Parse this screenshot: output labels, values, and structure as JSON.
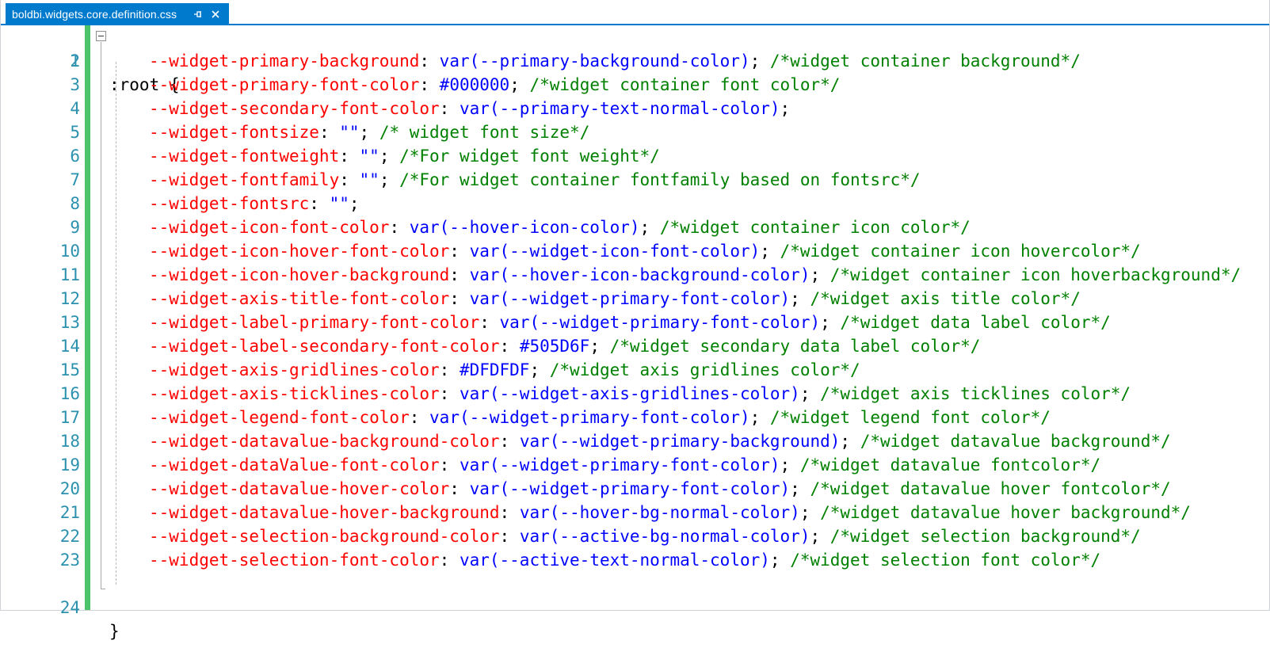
{
  "tab": {
    "title": "boldbi.widgets.core.definition.css",
    "pin_icon": "pin-icon",
    "close_icon": "close-icon"
  },
  "colors": {
    "accent": "#007acc",
    "line_number": "#2b91af",
    "property": "#ff0000",
    "value": "#0000ff",
    "comment": "#008000",
    "change_bar": "#4ec46a"
  },
  "code": {
    "open": ":root {",
    "close": "}",
    "lines": [
      {
        "n": "2",
        "prop": "--widget-primary-background",
        "sep": ": ",
        "val": "var(--primary-background-color)",
        "end": "; ",
        "cmt": "/*widget container background*/"
      },
      {
        "n": "3",
        "prop": "--widget-primary-font-color",
        "sep": ": ",
        "val": "#000000",
        "end": "; ",
        "cmt": "/*widget container font color*/"
      },
      {
        "n": "4",
        "prop": "--widget-secondary-font-color",
        "sep": ": ",
        "val": "var(--primary-text-normal-color)",
        "end": ";",
        "cmt": ""
      },
      {
        "n": "5",
        "prop": "--widget-fontsize",
        "sep": ": ",
        "val": "\"\"",
        "end": "; ",
        "cmt": "/* widget font size*/"
      },
      {
        "n": "6",
        "prop": "--widget-fontweight",
        "sep": ": ",
        "val": "\"\"",
        "end": "; ",
        "cmt": "/*For widget font weight*/"
      },
      {
        "n": "7",
        "prop": "--widget-fontfamily",
        "sep": ": ",
        "val": "\"\"",
        "end": "; ",
        "cmt": "/*For widget container fontfamily based on fontsrc*/"
      },
      {
        "n": "8",
        "prop": "--widget-fontsrc",
        "sep": ": ",
        "val": "\"\"",
        "end": ";",
        "cmt": ""
      },
      {
        "n": "9",
        "prop": "--widget-icon-font-color",
        "sep": ": ",
        "val": "var(--hover-icon-color)",
        "end": "; ",
        "cmt": "/*widget container icon color*/"
      },
      {
        "n": "10",
        "prop": "--widget-icon-hover-font-color",
        "sep": ": ",
        "val": "var(--widget-icon-font-color)",
        "end": "; ",
        "cmt": "/*widget container icon hovercolor*/"
      },
      {
        "n": "11",
        "prop": "--widget-icon-hover-background",
        "sep": ": ",
        "val": "var(--hover-icon-background-color)",
        "end": "; ",
        "cmt": "/*widget container icon hoverbackground*/"
      },
      {
        "n": "12",
        "prop": "--widget-axis-title-font-color",
        "sep": ": ",
        "val": "var(--widget-primary-font-color)",
        "end": "; ",
        "cmt": "/*widget axis title color*/"
      },
      {
        "n": "13",
        "prop": "--widget-label-primary-font-color",
        "sep": ": ",
        "val": "var(--widget-primary-font-color)",
        "end": "; ",
        "cmt": "/*widget data label color*/"
      },
      {
        "n": "14",
        "prop": "--widget-label-secondary-font-color",
        "sep": ": ",
        "val": "#505D6F",
        "end": "; ",
        "cmt": "/*widget secondary data label color*/"
      },
      {
        "n": "15",
        "prop": "--widget-axis-gridlines-color",
        "sep": ": ",
        "val": "#DFDFDF",
        "end": "; ",
        "cmt": "/*widget axis gridlines color*/"
      },
      {
        "n": "16",
        "prop": "--widget-axis-ticklines-color",
        "sep": ": ",
        "val": "var(--widget-axis-gridlines-color)",
        "end": "; ",
        "cmt": "/*widget axis ticklines color*/"
      },
      {
        "n": "17",
        "prop": "--widget-legend-font-color",
        "sep": ": ",
        "val": "var(--widget-primary-font-color)",
        "end": "; ",
        "cmt": "/*widget legend font color*/"
      },
      {
        "n": "18",
        "prop": "--widget-datavalue-background-color",
        "sep": ": ",
        "val": "var(--widget-primary-background)",
        "end": "; ",
        "cmt": "/*widget datavalue background*/"
      },
      {
        "n": "19",
        "prop": "--widget-dataValue-font-color",
        "sep": ": ",
        "val": "var(--widget-primary-font-color)",
        "end": "; ",
        "cmt": "/*widget datavalue fontcolor*/"
      },
      {
        "n": "20",
        "prop": "--widget-datavalue-hover-color",
        "sep": ": ",
        "val": "var(--widget-primary-font-color)",
        "end": "; ",
        "cmt": "/*widget datavalue hover fontcolor*/"
      },
      {
        "n": "21",
        "prop": "--widget-datavalue-hover-background",
        "sep": ": ",
        "val": "var(--hover-bg-normal-color)",
        "end": "; ",
        "cmt": "/*widget datavalue hover background*/"
      },
      {
        "n": "22",
        "prop": "--widget-selection-background-color",
        "sep": ": ",
        "val": "var(--active-bg-normal-color)",
        "end": "; ",
        "cmt": "/*widget selection background*/"
      },
      {
        "n": "23",
        "prop": "--widget-selection-font-color",
        "sep": ": ",
        "val": "var(--active-text-normal-color)",
        "end": "; ",
        "cmt": "/*widget selection font color*/"
      }
    ],
    "first_line_number": "1",
    "last_line_number": "24"
  }
}
